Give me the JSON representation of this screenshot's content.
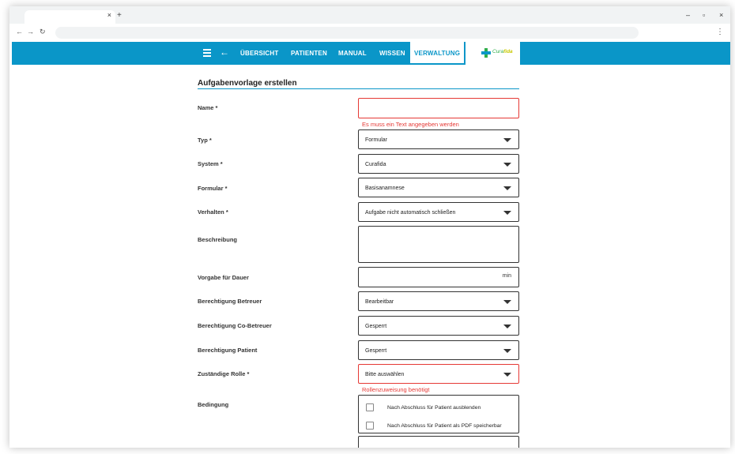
{
  "browser": {
    "tab_close": "×",
    "new_tab": "+",
    "minimize": "–",
    "restore": "▫",
    "close": "×",
    "back": "←",
    "forward": "→",
    "reload": "↻",
    "menu": "⋮"
  },
  "nav": {
    "items": [
      "ÜBERSICHT",
      "PATIENTEN",
      "MANUAL",
      "WISSEN",
      "VERWALTUNG"
    ],
    "active": "VERWALTUNG",
    "logo_text": "Cura",
    "logo_text2": "fida"
  },
  "form": {
    "title": "Aufgabenvorlage erstellen",
    "fields": [
      {
        "label": "Name *",
        "value": "",
        "error": "Es muss ein Text angegeben werden"
      },
      {
        "label": "Typ *",
        "value": "Formular"
      },
      {
        "label": "System *",
        "value": "Curafida"
      },
      {
        "label": "Formular *",
        "value": "Basisanamnese"
      },
      {
        "label": "Verhalten *",
        "value": "Aufgabe nicht automatisch schließen"
      },
      {
        "label": "Beschreibung",
        "value": ""
      },
      {
        "label": "Vorgabe für Dauer",
        "value": "",
        "suffix": "min"
      },
      {
        "label": "Berechtigung Betreuer",
        "value": "Bearbeitbar"
      },
      {
        "label": "Berechtigung Co-Betreuer",
        "value": "Gesperrt"
      },
      {
        "label": "Berechtigung Patient",
        "value": "Gesperrt"
      },
      {
        "label": "Zuständige Rolle *",
        "value": "Bitte auswählen",
        "error": "Rollenzuweisung benötigt"
      },
      {
        "label": "Bedingung"
      }
    ],
    "conditions": [
      {
        "label": "Nach Abschluss für Patient ausblenden",
        "checked": false
      },
      {
        "label": "Nach Abschluss für Patient als PDF speicherbar",
        "checked": false
      }
    ]
  },
  "colors": {
    "primary": "#0a96c8",
    "error": "#e53935"
  }
}
